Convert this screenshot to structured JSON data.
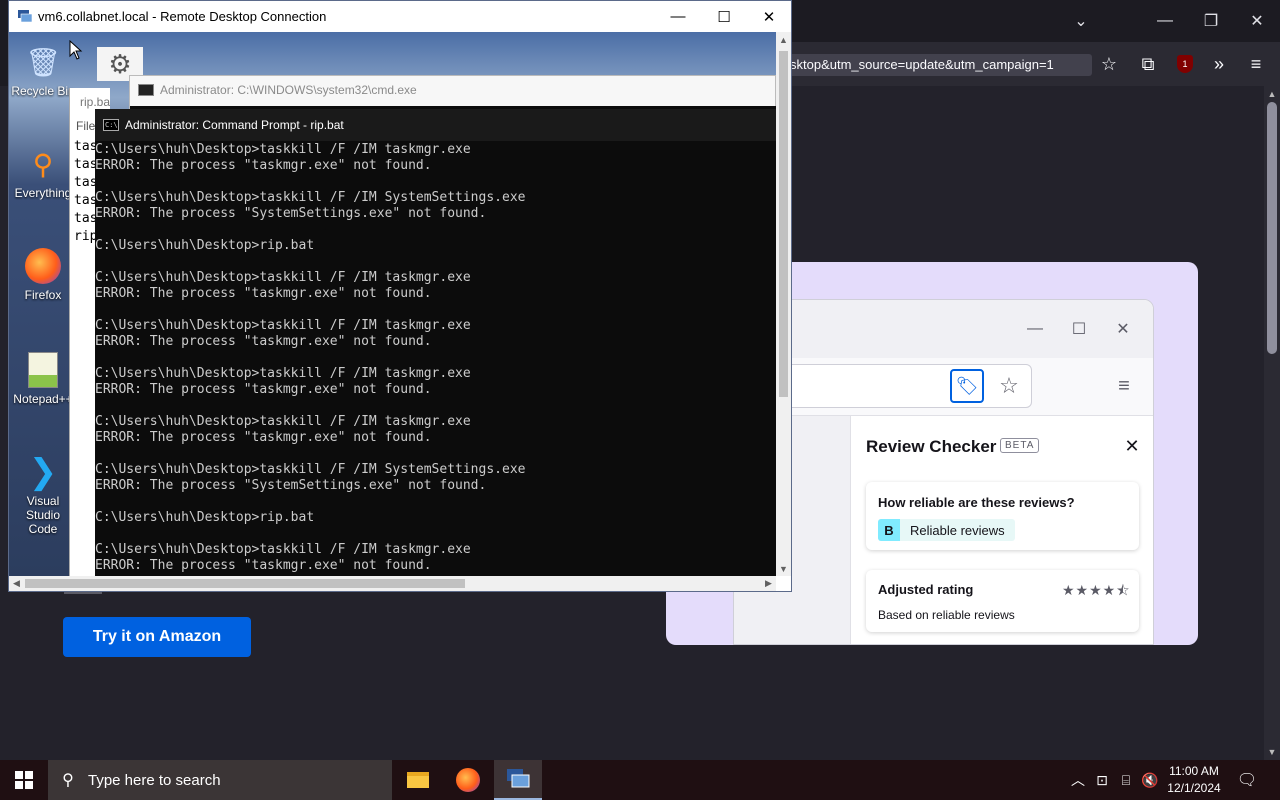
{
  "firefox": {
    "url_text": "sktop&utm_source=update&utm_campaign=1",
    "promo_button": "Try it on Amazon",
    "review_checker": {
      "title": "Review Checker",
      "badge": "BETA",
      "question": "How reliable are these reviews?",
      "grade_letter": "B",
      "grade_text": "Reliable reviews",
      "rating_title": "Adjusted rating",
      "rating_sub": "Based on reliable reviews",
      "rating_stars": 4.5
    },
    "extension_badge": "1"
  },
  "rdp": {
    "title": "vm6.collabnet.local - Remote Desktop Connection",
    "desktop_icons": [
      {
        "label": "Recycle Bin",
        "icon": "recycle-bin-icon"
      },
      {
        "label": "Everything",
        "icon": "everything-search-icon"
      },
      {
        "label": "Firefox",
        "icon": "firefox-icon"
      },
      {
        "label": "Notepad++",
        "icon": "notepad-plus-plus-icon"
      },
      {
        "label": "Visual Studio Code",
        "icon": "vscode-icon"
      }
    ],
    "notepad": {
      "title": "rip.bat",
      "menu": "File",
      "lines": [
        "tas",
        "tas",
        "tas",
        "tas",
        "tas",
        "rip"
      ]
    },
    "cmd_back_title": "Administrator: C:\\WINDOWS\\system32\\cmd.exe",
    "cmd_title": "Administrator: Command Prompt - rip.bat",
    "cmd_lines": [
      "C:\\Users\\huh\\Desktop>taskkill /F /IM taskmgr.exe",
      "ERROR: The process \"taskmgr.exe\" not found.",
      "",
      "C:\\Users\\huh\\Desktop>taskkill /F /IM SystemSettings.exe",
      "ERROR: The process \"SystemSettings.exe\" not found.",
      "",
      "C:\\Users\\huh\\Desktop>rip.bat",
      "",
      "C:\\Users\\huh\\Desktop>taskkill /F /IM taskmgr.exe",
      "ERROR: The process \"taskmgr.exe\" not found.",
      "",
      "C:\\Users\\huh\\Desktop>taskkill /F /IM taskmgr.exe",
      "ERROR: The process \"taskmgr.exe\" not found.",
      "",
      "C:\\Users\\huh\\Desktop>taskkill /F /IM taskmgr.exe",
      "ERROR: The process \"taskmgr.exe\" not found.",
      "",
      "C:\\Users\\huh\\Desktop>taskkill /F /IM taskmgr.exe",
      "ERROR: The process \"taskmgr.exe\" not found.",
      "",
      "C:\\Users\\huh\\Desktop>taskkill /F /IM SystemSettings.exe",
      "ERROR: The process \"SystemSettings.exe\" not found.",
      "",
      "C:\\Users\\huh\\Desktop>rip.bat",
      "",
      "C:\\Users\\huh\\Desktop>taskkill /F /IM taskmgr.exe",
      "ERROR: The process \"taskmgr.exe\" not found."
    ]
  },
  "taskbar": {
    "search_placeholder": "Type here to search",
    "time": "11:00 AM",
    "date": "12/1/2024",
    "accent": "#1f0f12"
  }
}
